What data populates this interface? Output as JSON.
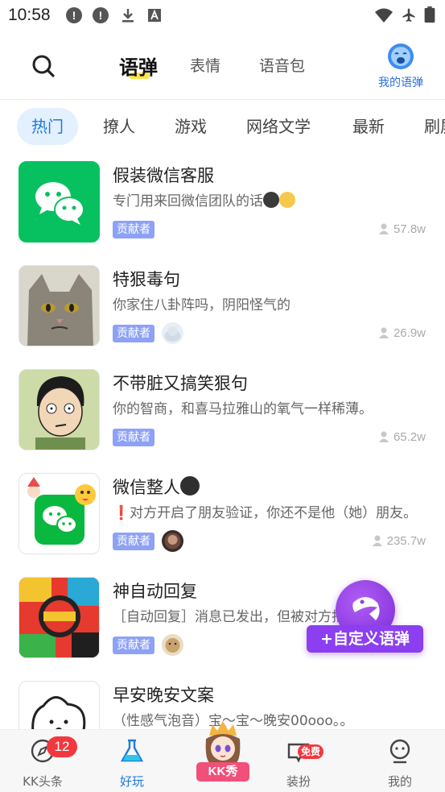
{
  "status_bar": {
    "time": "10:58"
  },
  "top_nav": {
    "tabs": [
      {
        "label": "语弹"
      },
      {
        "label": "表情"
      },
      {
        "label": "语音包"
      }
    ],
    "my_label": "我的语弹"
  },
  "categories": [
    "热门",
    "撩人",
    "游戏",
    "网络文学",
    "最新",
    "刷屏"
  ],
  "items": [
    {
      "title": "假装微信客服",
      "desc": "专门用来回微信团队的话",
      "badge": "贡献者",
      "count": "57.8w"
    },
    {
      "title": "特狠毒句",
      "desc": "你家住八卦阵吗，阴阳怪气的",
      "badge": "贡献者",
      "count": "26.9w"
    },
    {
      "title": "不带脏又搞笑狠句",
      "desc": "你的智商，和喜马拉雅山的氧气一样稀薄。",
      "badge": "贡献者",
      "count": "65.2w"
    },
    {
      "title": "微信整人",
      "desc": "❗对方开启了朋友验证，你还不是他（她）朋友。",
      "badge": "贡献者",
      "count": "235.7w"
    },
    {
      "title": "神自动回复",
      "desc": "［自动回复］消息已发出，但被对方拒收了。",
      "badge": "贡献者",
      "count": ""
    },
    {
      "title": "早安晚安文案",
      "desc": "（性感气泡音）宝～宝～晚安00ooo。。",
      "badge": "",
      "count": ""
    }
  ],
  "fab": {
    "label": "+自定义语弹"
  },
  "tabbar": {
    "tabs": [
      {
        "label": "KK头条",
        "badge": "12"
      },
      {
        "label": "好玩"
      },
      {
        "label": "KK秀"
      },
      {
        "label": "装扮",
        "badge": "免费"
      },
      {
        "label": "我的"
      }
    ]
  },
  "colors": {
    "accent": "#1f7ae0",
    "badge": "#8ea2f5",
    "fab": "#8b3ff0",
    "wechat": "#07c160"
  }
}
